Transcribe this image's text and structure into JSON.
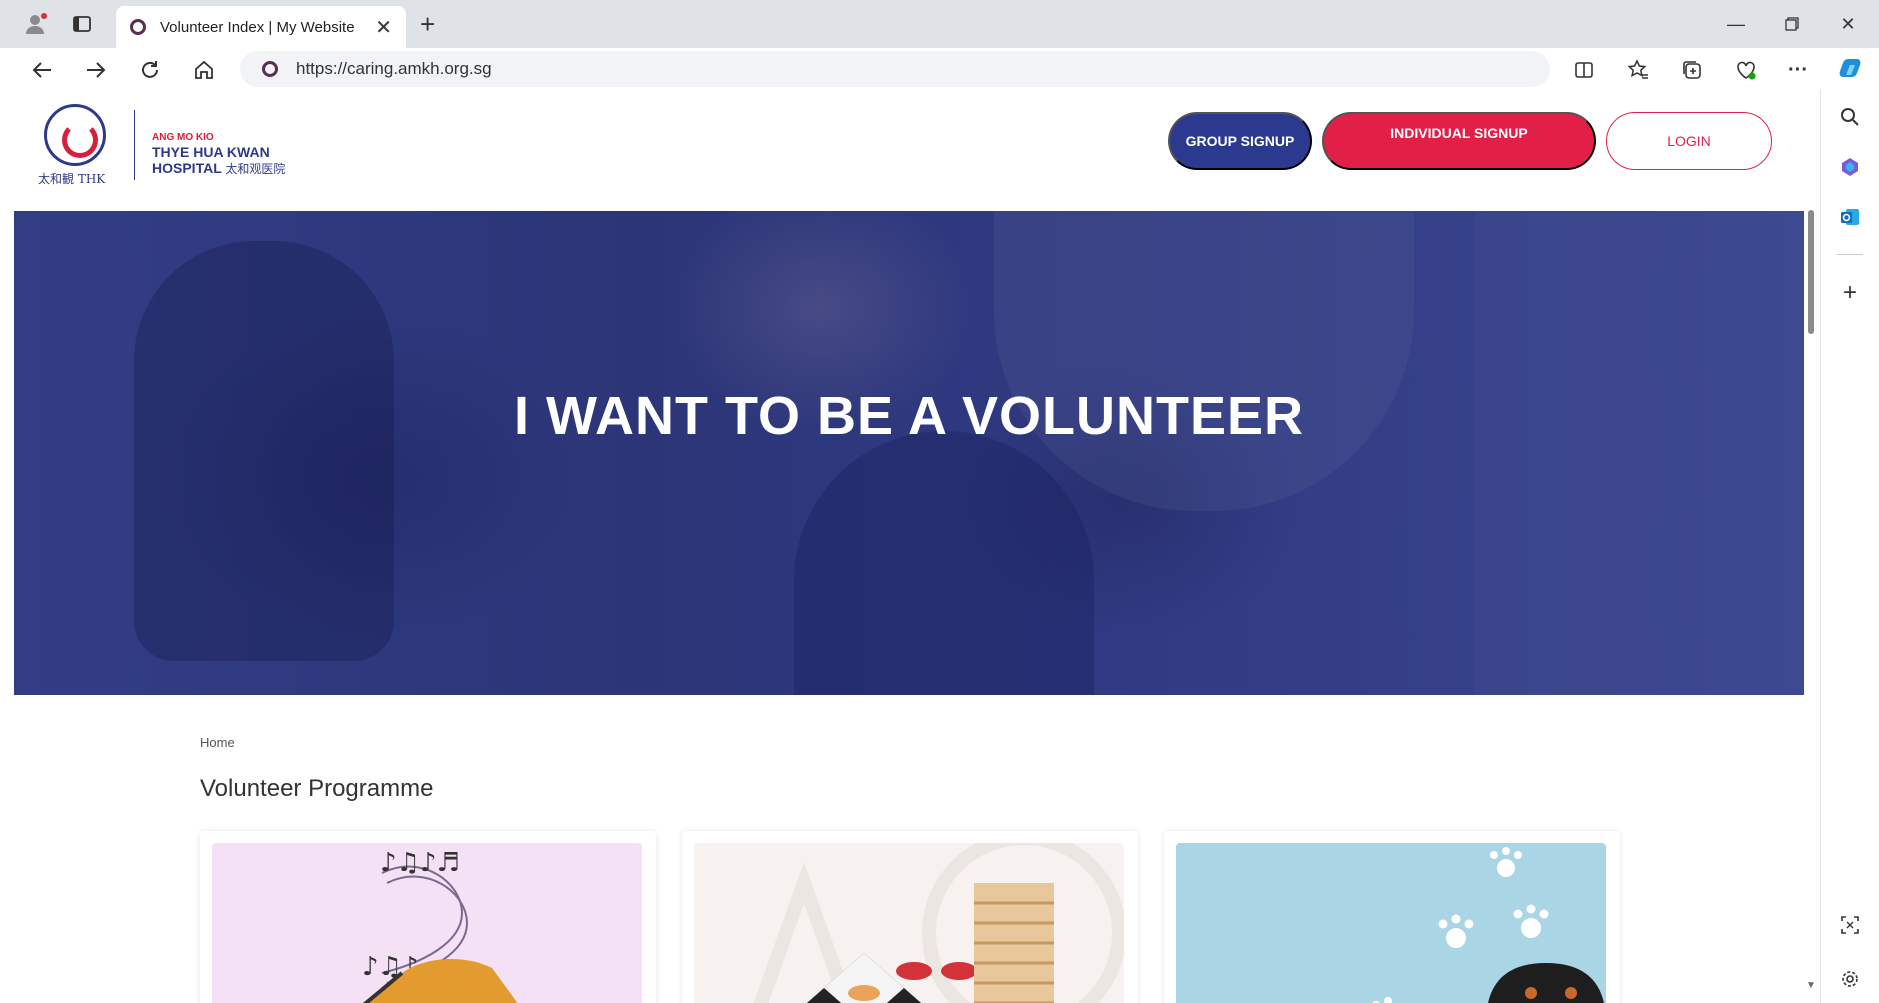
{
  "browser": {
    "tab_title": "Volunteer Index | My Website",
    "url": "https://caring.amkh.org.sg",
    "icons": [
      "profile-icon",
      "tab-actions-icon",
      "favicon",
      "close-icon",
      "new-tab-icon",
      "minimize-icon",
      "restore-icon",
      "window-close-icon",
      "back-icon",
      "forward-icon",
      "refresh-icon",
      "home-icon",
      "site-info-icon",
      "split-screen-icon",
      "favorites-icon",
      "collections-icon",
      "browser-essentials-icon",
      "more-icon",
      "copilot-icon"
    ]
  },
  "edge_sidebar": {
    "icons": [
      "search-icon",
      "copilot-app-icon",
      "outlook-icon",
      "add-icon",
      "screenshot-icon",
      "settings-icon"
    ]
  },
  "site": {
    "logo": {
      "thk_text": "太和観 THK",
      "line1": "ANG MO KIO",
      "line2": "THYE HUA KWAN",
      "line3": "HOSPITAL",
      "line3_cn": "太和观医院"
    },
    "buttons": {
      "group_signup": "GROUP SIGNUP",
      "individual_signup": "INDIVIDUAL SIGNUP",
      "login": "LOGIN"
    },
    "colors": {
      "primary_blue": "#2b3a8f",
      "accent_red": "#e21f47"
    }
  },
  "hero": {
    "headline": "I WANT TO BE A VOLUNTEER"
  },
  "main": {
    "breadcrumb": "Home",
    "section_title": "Volunteer Programme",
    "cards": [
      {
        "image": "music-piano-illustration"
      },
      {
        "image": "board-games-illustration"
      },
      {
        "image": "pets-paw-prints-illustration"
      }
    ]
  }
}
